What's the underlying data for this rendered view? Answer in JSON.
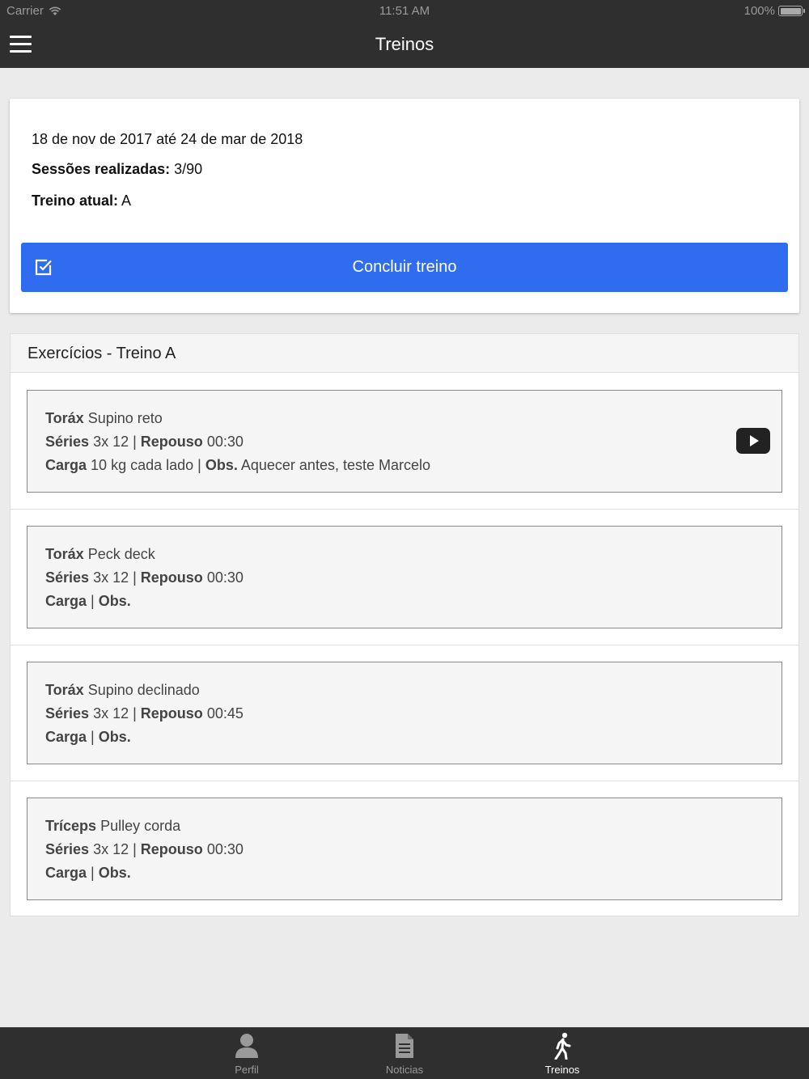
{
  "status_bar": {
    "carrier": "Carrier",
    "time": "11:51 AM",
    "battery": "100%"
  },
  "nav": {
    "title": "Treinos",
    "menu_icon": "hamburger-menu-icon"
  },
  "summary": {
    "period": "18 de nov de 2017 até 24 de mar de 2018",
    "sessions_label": "Sessões realizadas:",
    "sessions_value": "3/90",
    "current_label": "Treino atual:",
    "current_value": "A",
    "conclude_button": "Concluir treino",
    "accent_color": "#2f6cf0"
  },
  "exercises": {
    "header": "Exercícios - Treino A",
    "items": [
      {
        "group": "Toráx",
        "name": "Supino reto",
        "series_label": "Séries",
        "series": "3x 12",
        "rest_label": "Repouso",
        "rest": "00:30",
        "load_label": "Carga",
        "load": "10 kg cada lado",
        "obs_label": "Obs.",
        "obs": "Aquecer antes, teste Marcelo",
        "has_video": true
      },
      {
        "group": "Toráx",
        "name": "Peck deck",
        "series_label": "Séries",
        "series": "3x 12",
        "rest_label": "Repouso",
        "rest": "00:30",
        "load_label": "Carga",
        "load": "",
        "obs_label": "Obs.",
        "obs": "",
        "has_video": false
      },
      {
        "group": "Toráx",
        "name": "Supino declinado",
        "series_label": "Séries",
        "series": "3x 12",
        "rest_label": "Repouso",
        "rest": "00:45",
        "load_label": "Carga",
        "load": "",
        "obs_label": "Obs.",
        "obs": "",
        "has_video": false
      },
      {
        "group": "Tríceps",
        "name": "Pulley corda",
        "series_label": "Séries",
        "series": "3x 12",
        "rest_label": "Repouso",
        "rest": "00:30",
        "load_label": "Carga",
        "load": "",
        "obs_label": "Obs.",
        "obs": "",
        "has_video": false
      }
    ]
  },
  "tabs": [
    {
      "label": "Perfil",
      "icon": "person-icon",
      "active": false
    },
    {
      "label": "Noticias",
      "icon": "document-icon",
      "active": false
    },
    {
      "label": "Treinos",
      "icon": "walking-icon",
      "active": true
    }
  ]
}
